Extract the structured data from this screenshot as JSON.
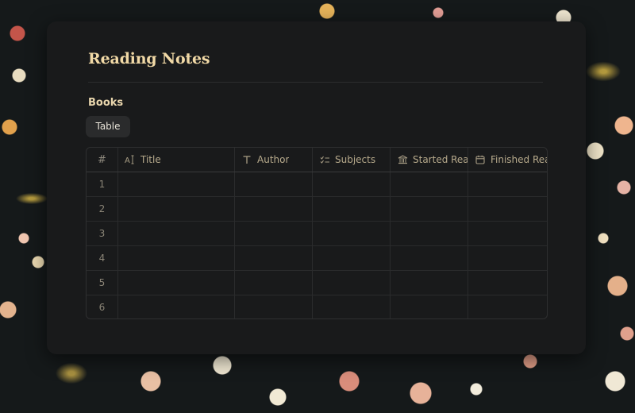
{
  "page": {
    "title": "Reading Notes"
  },
  "database": {
    "title": "Books",
    "views": [
      {
        "label": "Table",
        "active": true
      }
    ],
    "columns": [
      {
        "key": "row_number",
        "label": "#",
        "icon": "hash"
      },
      {
        "key": "title",
        "label": "Title",
        "icon": "text-type-icon"
      },
      {
        "key": "author",
        "label": "Author",
        "icon": "text-icon"
      },
      {
        "key": "subjects",
        "label": "Subjects",
        "icon": "multi-select-icon"
      },
      {
        "key": "started",
        "label": "Started Reading",
        "icon": "bank-icon"
      },
      {
        "key": "finished",
        "label": "Finished Reading",
        "icon": "calendar-icon"
      }
    ],
    "rows": [
      {
        "number": "1",
        "title": "",
        "author": "",
        "subjects": "",
        "started": "",
        "finished": ""
      },
      {
        "number": "2",
        "title": "",
        "author": "",
        "subjects": "",
        "started": "",
        "finished": ""
      },
      {
        "number": "3",
        "title": "",
        "author": "",
        "subjects": "",
        "started": "",
        "finished": ""
      },
      {
        "number": "4",
        "title": "",
        "author": "",
        "subjects": "",
        "started": "",
        "finished": ""
      },
      {
        "number": "5",
        "title": "",
        "author": "",
        "subjects": "",
        "started": "",
        "finished": ""
      },
      {
        "number": "6",
        "title": "",
        "author": "",
        "subjects": "",
        "started": "",
        "finished": ""
      }
    ]
  },
  "colors": {
    "accent_title": "#f1d9a6",
    "card_background": "#191a1b",
    "tab_background": "#2a2b2c"
  }
}
